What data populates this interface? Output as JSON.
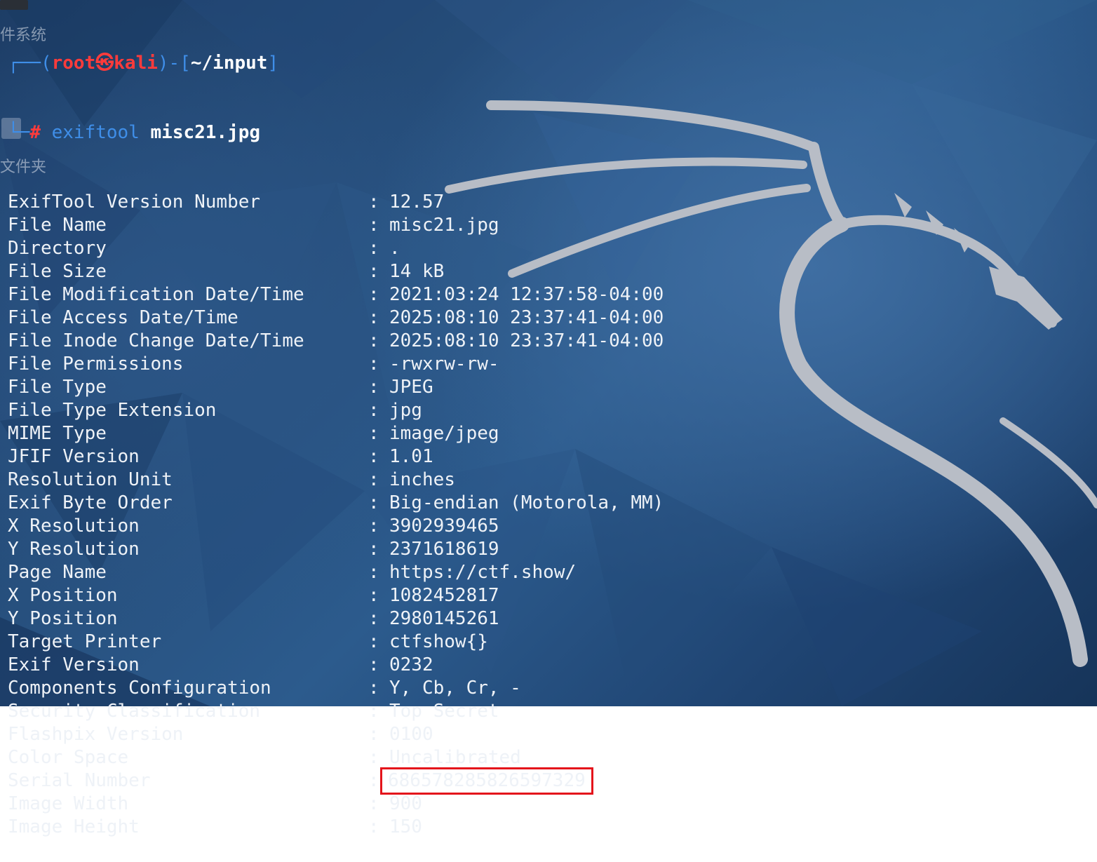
{
  "prompt": {
    "user": "root",
    "at_symbol": "㉿",
    "host": "kali",
    "path": "~/input",
    "hash": "#",
    "command": "exiftool",
    "argument": "misc21.jpg"
  },
  "desktop_labels": {
    "top": "件系统",
    "middle": "文件夹"
  },
  "rows": [
    {
      "key": "ExifTool Version Number",
      "value": "12.57"
    },
    {
      "key": "File Name",
      "value": "misc21.jpg"
    },
    {
      "key": "Directory",
      "value": "."
    },
    {
      "key": "File Size",
      "value": "14 kB"
    },
    {
      "key": "File Modification Date/Time",
      "value": "2021:03:24 12:37:58-04:00"
    },
    {
      "key": "File Access Date/Time",
      "value": "2025:08:10 23:37:41-04:00"
    },
    {
      "key": "File Inode Change Date/Time",
      "value": "2025:08:10 23:37:41-04:00"
    },
    {
      "key": "File Permissions",
      "value": "-rwxrw-rw-"
    },
    {
      "key": "File Type",
      "value": "JPEG"
    },
    {
      "key": "File Type Extension",
      "value": "jpg"
    },
    {
      "key": "MIME Type",
      "value": "image/jpeg"
    },
    {
      "key": "JFIF Version",
      "value": "1.01"
    },
    {
      "key": "Resolution Unit",
      "value": "inches"
    },
    {
      "key": "Exif Byte Order",
      "value": "Big-endian (Motorola, MM)"
    },
    {
      "key": "X Resolution",
      "value": "3902939465"
    },
    {
      "key": "Y Resolution",
      "value": "2371618619"
    },
    {
      "key": "Page Name",
      "value": "https://ctf.show/"
    },
    {
      "key": "X Position",
      "value": "1082452817"
    },
    {
      "key": "Y Position",
      "value": "2980145261"
    },
    {
      "key": "Target Printer",
      "value": "ctfshow{}"
    },
    {
      "key": "Exif Version",
      "value": "0232"
    },
    {
      "key": "Components Configuration",
      "value": "Y, Cb, Cr, -"
    },
    {
      "key": "Security Classification",
      "value": "Top Secret"
    },
    {
      "key": "Flashpix Version",
      "value": "0100"
    },
    {
      "key": "Color Space",
      "value": "Uncalibrated"
    },
    {
      "key": "Serial Number",
      "value": "686578285826597329"
    },
    {
      "key": "Image Width",
      "value": "900"
    },
    {
      "key": "Image Height",
      "value": "150"
    }
  ],
  "separator": ":",
  "highlighted_row_key": "Serial Number",
  "colors": {
    "highlight_box": "#e4141b",
    "prompt_blue": "#3f8ee8",
    "prompt_red": "#ff3b3b",
    "text": "#eef2f7"
  }
}
